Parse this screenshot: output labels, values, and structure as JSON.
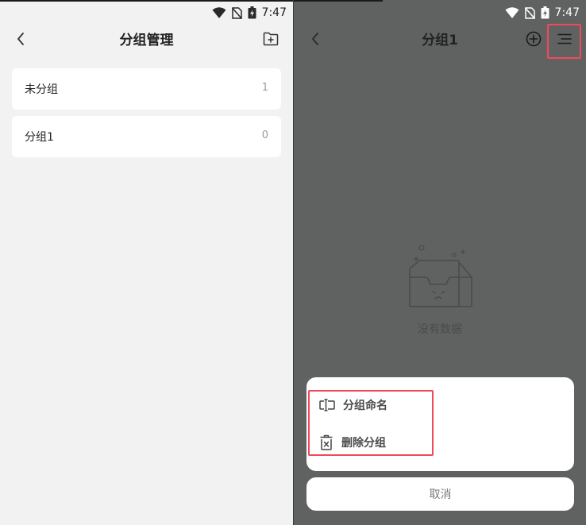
{
  "status": {
    "time": "7:47"
  },
  "groups_screen": {
    "title": "分组管理",
    "groups": [
      {
        "name": "未分组",
        "count": "1"
      },
      {
        "name": "分组1",
        "count": "0"
      }
    ]
  },
  "group_detail_screen": {
    "title": "分组1",
    "empty_text": "没有数据",
    "actions": [
      {
        "label": "分组命名",
        "icon": "rename-icon"
      },
      {
        "label": "删除分组",
        "icon": "delete-group-icon"
      }
    ],
    "cancel_label": "取消"
  },
  "colors": {
    "left_background": "#f1f2f1",
    "dimmed_background": "#606261",
    "card": "#ffffff",
    "highlight": "#ee4a5a"
  }
}
